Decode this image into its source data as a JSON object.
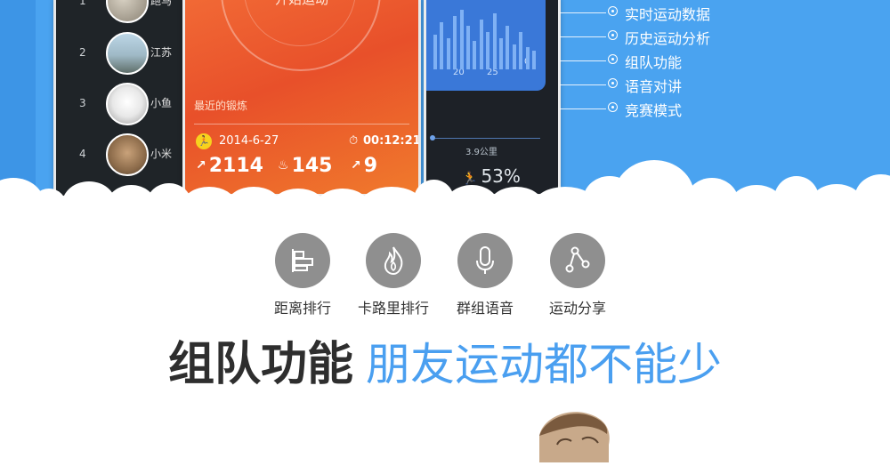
{
  "colors": {
    "banner_blue": "#4aa3f0",
    "accent_blue": "#4a9ff0",
    "headline_dark": "#2e2e2e",
    "icon_gray": "#8f8f8f",
    "run_orange": "#ee5f2e"
  },
  "ranking": {
    "rows": [
      {
        "rank": "1",
        "name": "跑马"
      },
      {
        "rank": "2",
        "name": "江苏"
      },
      {
        "rank": "3",
        "name": "小鱼"
      },
      {
        "rank": "4",
        "name": "小米"
      }
    ]
  },
  "run": {
    "start_label": "开始运动",
    "recent_label": "最近的锻炼",
    "date": "2014-6-27",
    "duration": "00:12:21",
    "distance_value": "2114",
    "calories_value": "145",
    "climb_value": "9"
  },
  "stats_chart": {
    "x_ticks": [
      "20",
      "25"
    ],
    "y_tick": "0",
    "distance_label": "3.9公里",
    "percent": "53%",
    "bar_levels": [
      0.55,
      0.75,
      0.5,
      0.85,
      0.95,
      0.7,
      0.45,
      0.8,
      0.6,
      0.9,
      0.5,
      0.7,
      0.4,
      0.6,
      0.35,
      0.3
    ]
  },
  "features": [
    {
      "label": "实时运动数据",
      "icon": "target-dot-icon"
    },
    {
      "label": "历史运动分析",
      "icon": "target-dot-icon"
    },
    {
      "label": "组队功能",
      "icon": "target-dot-icon"
    },
    {
      "label": "语音对讲",
      "icon": "target-dot-icon"
    },
    {
      "label": "竞赛模式",
      "icon": "target-dot-icon"
    }
  ],
  "icons": [
    {
      "label": "距离排行",
      "icon": "distance-rank-icon"
    },
    {
      "label": "卡路里排行",
      "icon": "flame-icon"
    },
    {
      "label": "群组语音",
      "icon": "microphone-icon"
    },
    {
      "label": "运动分享",
      "icon": "share-icon"
    }
  ],
  "headline": {
    "bold": "组队功能",
    "light": "朋友运动都不能少"
  }
}
